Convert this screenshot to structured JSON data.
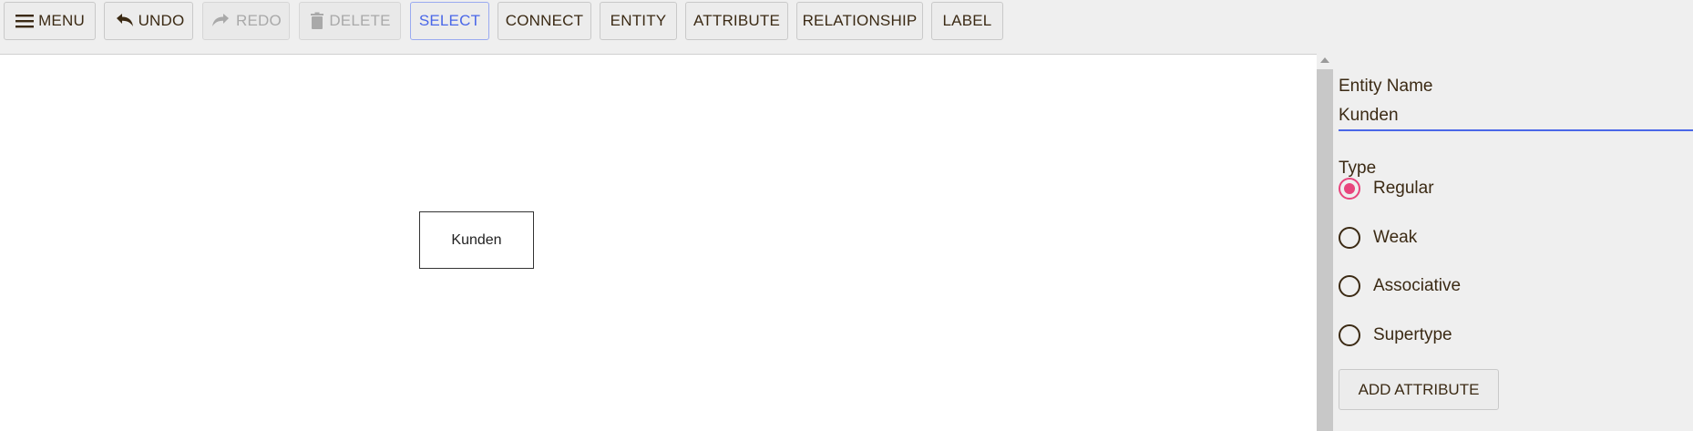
{
  "toolbar": {
    "menu_label": "MENU",
    "undo_label": "UNDO",
    "redo_label": "REDO",
    "delete_label": "DELETE",
    "select_label": "SELECT",
    "connect_label": "CONNECT",
    "entity_label": "ENTITY",
    "attribute_label": "ATTRIBUTE",
    "relationship_label": "RELATIONSHIP",
    "label_label": "LABEL",
    "icons": {
      "menu": "hamburger-icon",
      "undo": "undo-arrow-icon",
      "redo": "redo-arrow-icon",
      "delete": "trash-icon"
    },
    "disabled": [
      "REDO",
      "DELETE"
    ],
    "active_tool": "SELECT"
  },
  "canvas": {
    "entities": [
      {
        "name": "Kunden"
      }
    ]
  },
  "panel": {
    "entity_name_label": "Entity Name",
    "entity_name_value": "Kunden",
    "type_label": "Type",
    "type_options": [
      "Regular",
      "Weak",
      "Associative",
      "Supertype"
    ],
    "type_selected": "Regular",
    "add_attribute_label": "ADD ATTRIBUTE"
  },
  "colors": {
    "accent_blue": "#4a67e8",
    "radio_selected": "#e8457d",
    "text": "#3b2a14",
    "toolbar_bg": "#efefef",
    "canvas_bg": "#ffffff"
  }
}
